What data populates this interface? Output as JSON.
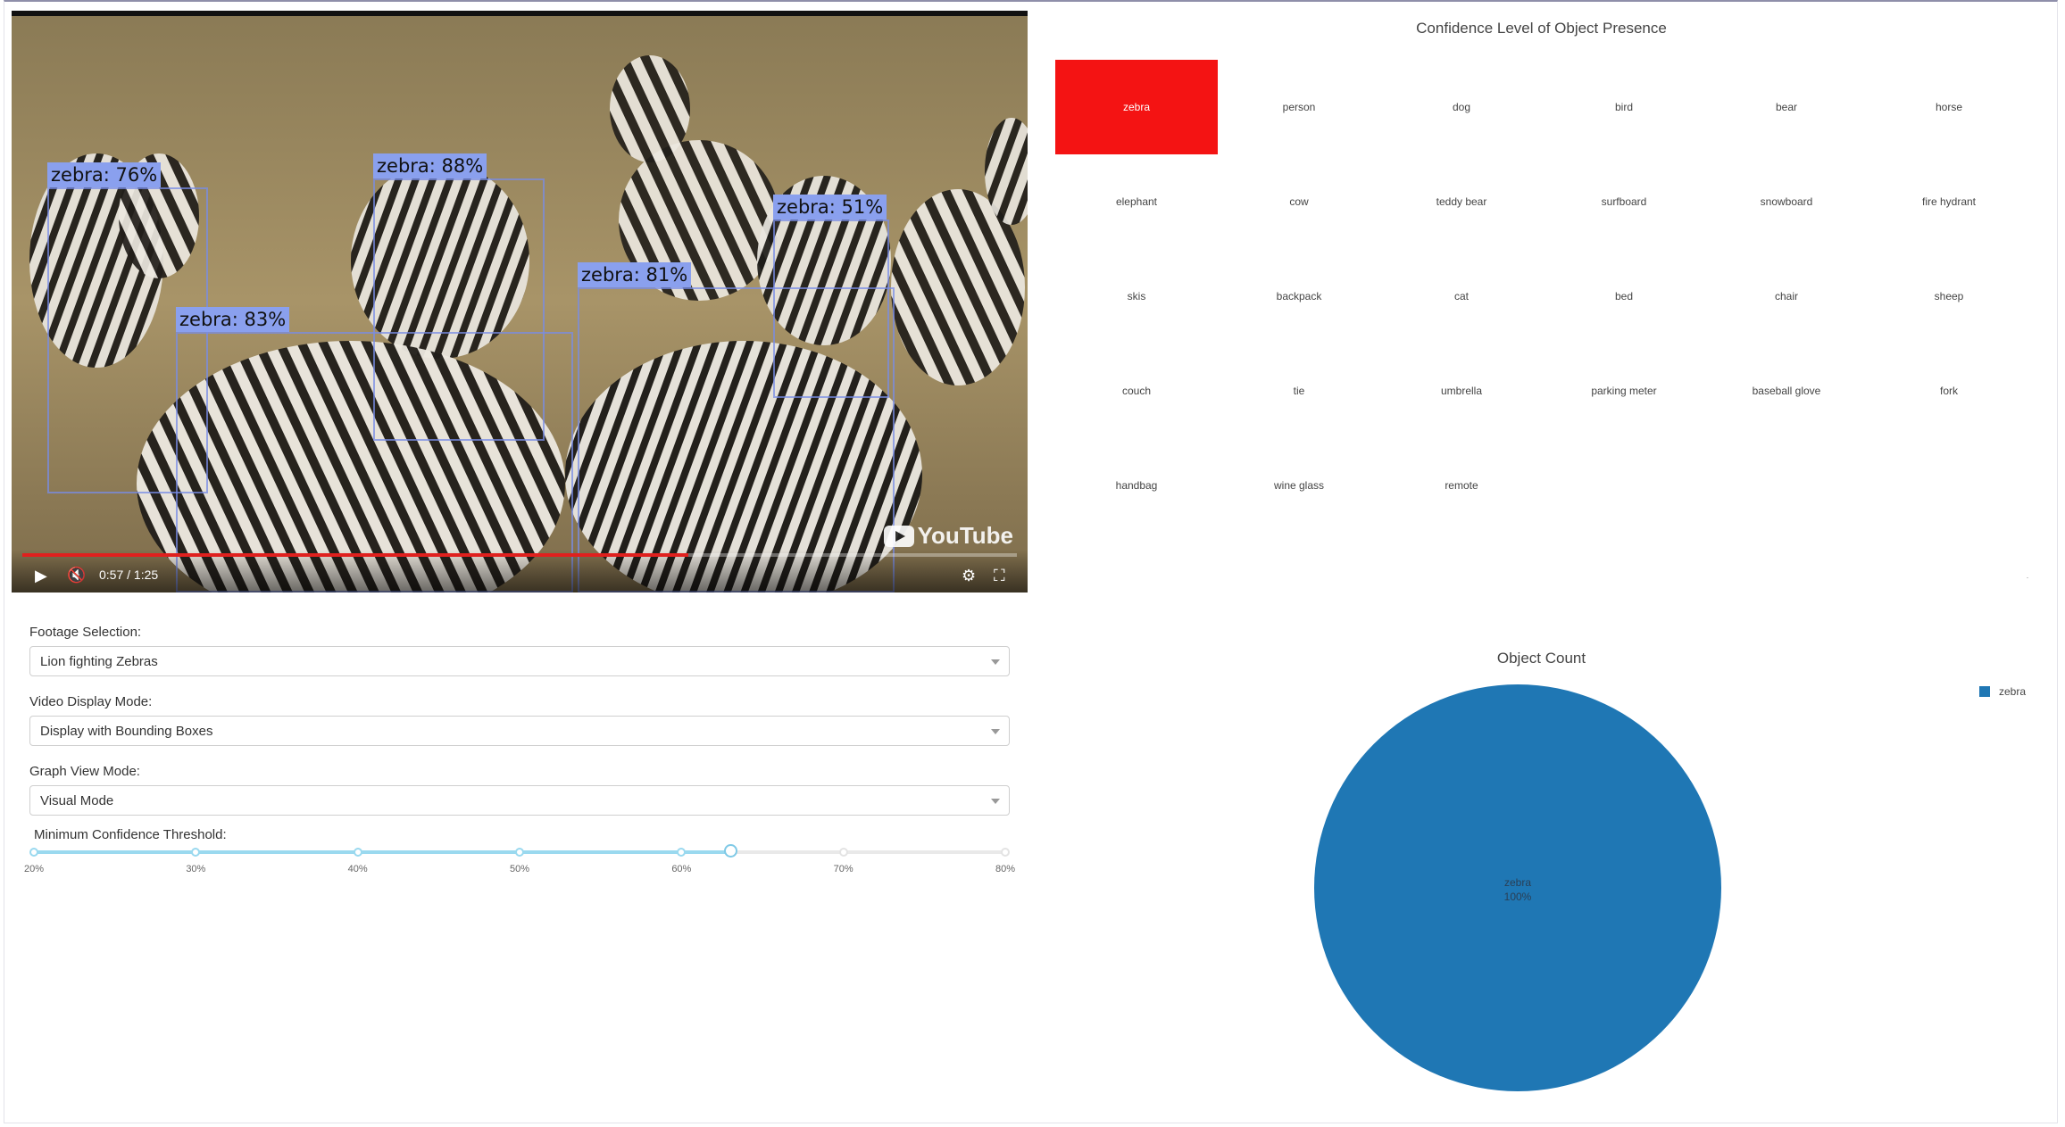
{
  "video": {
    "detections": [
      {
        "label": "zebra: 76%"
      },
      {
        "label": "zebra: 88%"
      },
      {
        "label": "zebra: 51%"
      },
      {
        "label": "zebra: 81%"
      },
      {
        "label": "zebra: 83%"
      }
    ],
    "watermark": "YouTube",
    "time": "0:57 / 1:25",
    "progress_fraction": 0.67,
    "colors": {
      "progress": "#e0201e",
      "bbox_label": "#8aa0ee"
    }
  },
  "form": {
    "footage": {
      "label": "Footage Selection:",
      "value": "Lion fighting Zebras"
    },
    "display_mode": {
      "label": "Video Display Mode:",
      "value": "Display with Bounding Boxes"
    },
    "graph_mode": {
      "label": "Graph View Mode:",
      "value": "Visual Mode"
    },
    "threshold": {
      "label": "Minimum Confidence Threshold:",
      "value": 63,
      "marks": [
        "20%",
        "30%",
        "40%",
        "50%",
        "60%",
        "70%",
        "80%"
      ]
    }
  },
  "confidence": {
    "title": "Confidence Level of Object Presence",
    "active_color": "#f41313",
    "items": [
      {
        "label": "zebra",
        "active": true
      },
      {
        "label": "person"
      },
      {
        "label": "dog"
      },
      {
        "label": "bird"
      },
      {
        "label": "bear"
      },
      {
        "label": "horse"
      },
      {
        "label": "elephant"
      },
      {
        "label": "cow"
      },
      {
        "label": "teddy bear"
      },
      {
        "label": "surfboard"
      },
      {
        "label": "snowboard"
      },
      {
        "label": "fire hydrant"
      },
      {
        "label": "skis"
      },
      {
        "label": "backpack"
      },
      {
        "label": "cat"
      },
      {
        "label": "bed"
      },
      {
        "label": "chair"
      },
      {
        "label": "sheep"
      },
      {
        "label": "couch"
      },
      {
        "label": "tie"
      },
      {
        "label": "umbrella"
      },
      {
        "label": "parking meter"
      },
      {
        "label": "baseball glove"
      },
      {
        "label": "fork"
      },
      {
        "label": "handbag"
      },
      {
        "label": "wine glass"
      },
      {
        "label": "remote"
      }
    ]
  },
  "chart_data": {
    "type": "pie",
    "title": "Object Count",
    "labels": [
      "zebra"
    ],
    "values": [
      100
    ],
    "slice_text": [
      "zebra",
      "100%"
    ],
    "colors": [
      "#1f77b4"
    ],
    "legend": {
      "position": "top-right",
      "entries": [
        "zebra"
      ]
    }
  }
}
